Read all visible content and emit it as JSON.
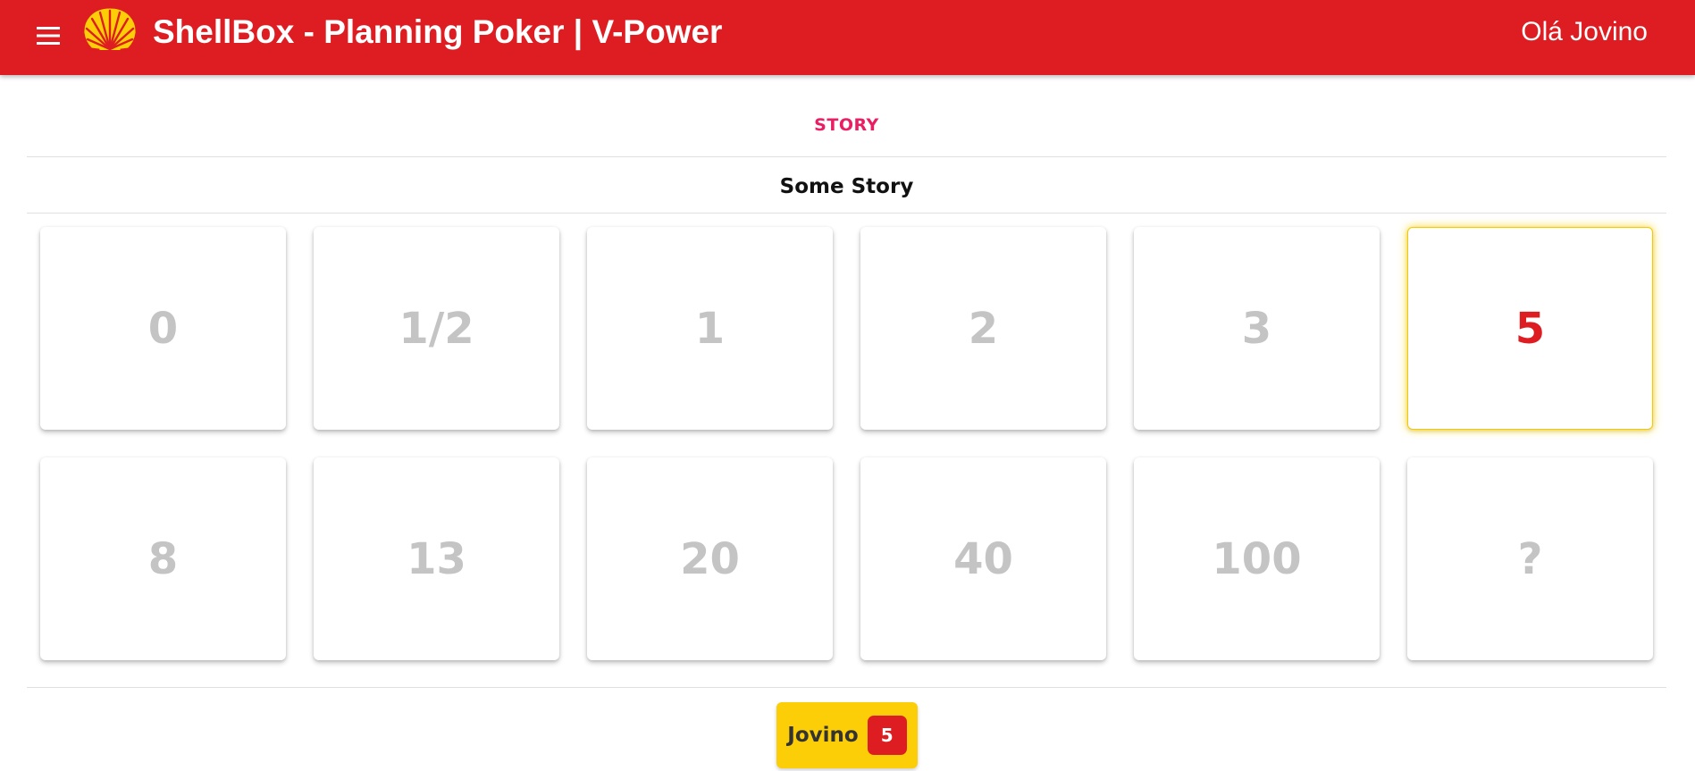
{
  "header": {
    "title": "ShellBox - Planning Poker | V-Power",
    "greeting": "Olá Jovino",
    "menu_icon": "menu-icon",
    "logo": "shell-logo",
    "background_color": "#dd1d21"
  },
  "story": {
    "section_label": "STORY",
    "name": "Some Story"
  },
  "cards": [
    {
      "value": "0",
      "selected": false
    },
    {
      "value": "1/2",
      "selected": false
    },
    {
      "value": "1",
      "selected": false
    },
    {
      "value": "2",
      "selected": false
    },
    {
      "value": "3",
      "selected": false
    },
    {
      "value": "5",
      "selected": true
    },
    {
      "value": "8",
      "selected": false
    },
    {
      "value": "13",
      "selected": false
    },
    {
      "value": "20",
      "selected": false
    },
    {
      "value": "40",
      "selected": false
    },
    {
      "value": "100",
      "selected": false
    },
    {
      "value": "?",
      "selected": false
    }
  ],
  "votes": [
    {
      "name": "Jovino",
      "value": "5"
    }
  ],
  "colors": {
    "accent_red": "#dd1d21",
    "accent_yellow": "#fbce07",
    "section_label": "#e91e63",
    "card_text": "#c4c4c4"
  }
}
